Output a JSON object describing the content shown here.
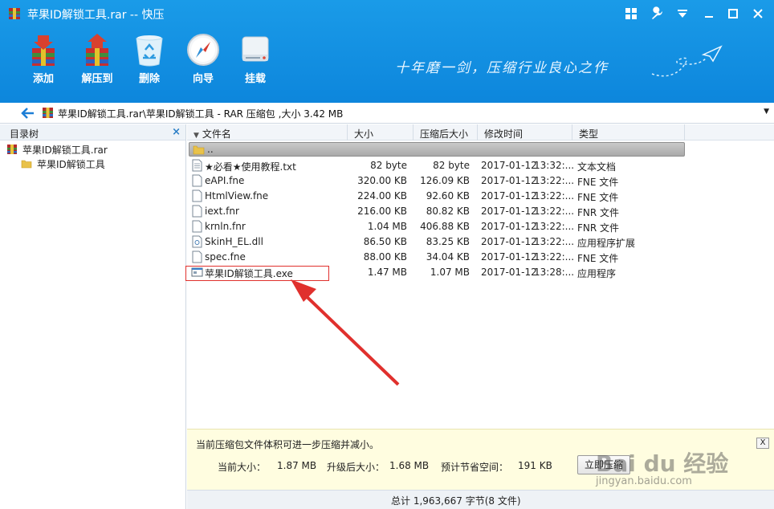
{
  "window": {
    "title": "苹果ID解锁工具.rar -- 快压",
    "controls": [
      "grid-icon",
      "wrench-icon",
      "dropdown-icon",
      "minimize-icon",
      "maximize-icon",
      "close-icon"
    ]
  },
  "toolbar": {
    "buttons": [
      {
        "label": "添加",
        "icon": "add-archive-icon"
      },
      {
        "label": "解压到",
        "icon": "extract-icon"
      },
      {
        "label": "删除",
        "icon": "recycle-bin-icon"
      },
      {
        "label": "向导",
        "icon": "compass-icon"
      },
      {
        "label": "挂载",
        "icon": "drive-icon"
      }
    ],
    "slogan": "十年磨一剑，压缩行业良心之作"
  },
  "address": {
    "path": "苹果ID解锁工具.rar\\苹果ID解锁工具 - RAR 压缩包 ,大小 3.42 MB"
  },
  "tree": {
    "title": "目录树",
    "close": "×",
    "items": [
      {
        "label": "苹果ID解锁工具.rar"
      },
      {
        "label": "苹果ID解锁工具"
      }
    ]
  },
  "columns": [
    "文件名",
    "大小",
    "压缩后大小",
    "修改时间",
    "类型"
  ],
  "updir": "..",
  "files": [
    {
      "name": "★必看★使用教程.txt",
      "size": "82 byte",
      "packed": "82 byte",
      "date": "2017-01-12",
      "time": "13:32:...",
      "type": "文本文档"
    },
    {
      "name": "eAPI.fne",
      "size": "320.00 KB",
      "packed": "126.09 KB",
      "date": "2017-01-12",
      "time": "13:22:...",
      "type": "FNE 文件"
    },
    {
      "name": "HtmlView.fne",
      "size": "224.00 KB",
      "packed": "92.60 KB",
      "date": "2017-01-12",
      "time": "13:22:...",
      "type": "FNE 文件"
    },
    {
      "name": "iext.fnr",
      "size": "216.00 KB",
      "packed": "80.82 KB",
      "date": "2017-01-12",
      "time": "13:22:...",
      "type": "FNR 文件"
    },
    {
      "name": "krnln.fnr",
      "size": "1.04 MB",
      "packed": "406.88 KB",
      "date": "2017-01-12",
      "time": "13:22:...",
      "type": "FNR 文件"
    },
    {
      "name": "SkinH_EL.dll",
      "size": "86.50 KB",
      "packed": "83.25 KB",
      "date": "2017-01-12",
      "time": "13:22:...",
      "type": "应用程序扩展"
    },
    {
      "name": "spec.fne",
      "size": "88.00 KB",
      "packed": "34.04 KB",
      "date": "2017-01-12",
      "time": "13:22:...",
      "type": "FNE 文件"
    },
    {
      "name": "苹果ID解锁工具.exe",
      "size": "1.47 MB",
      "packed": "1.07 MB",
      "date": "2017-01-12",
      "time": "13:28:...",
      "type": "应用程序"
    }
  ],
  "notice": {
    "message": "当前压缩包文件体积可进一步压缩并减小。",
    "close": "X",
    "current_label": "当前大小：",
    "current_value": "1.87 MB",
    "upgraded_label": "升级后大小：",
    "upgraded_value": "1.68 MB",
    "saved_label": "预计节省空间：",
    "saved_value": "191 KB",
    "button": "立即压缩"
  },
  "watermark": {
    "text": "Bai du 经验",
    "url": "jingyan.baidu.com"
  },
  "status": {
    "text": "总计 1,963,667 字节(8 文件)"
  },
  "colors": {
    "title_blue": "#0d86dc",
    "highlight_red": "#e0302d",
    "notice_bg": "#fffde0"
  }
}
